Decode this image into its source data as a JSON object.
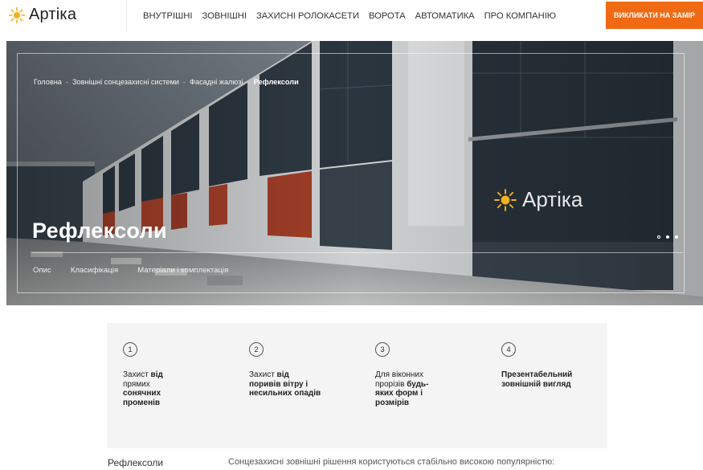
{
  "header": {
    "logo_text": "Артіка",
    "nav": [
      "ВНУТРІШНІ",
      "ЗОВНІШНІ",
      "ЗАХИСНІ РОЛОКАСЕТИ",
      "ВОРОТА",
      "АВТОМАТИКА",
      "ПРО КОМПАНІЮ"
    ],
    "cta": "ВИКЛИКАТИ НА ЗАМІР"
  },
  "hero": {
    "breadcrumb": [
      "Головна",
      "Зовнішні сонцезахисні системи",
      "Фасадні жалюзі",
      "Рефлексоли"
    ],
    "breadcrumb_sep": "-",
    "title": "Рефлексоли",
    "tabs": [
      "Опис",
      "Класифікація",
      "Матеріали і комплектація"
    ],
    "watermark": "Артіка"
  },
  "features": [
    {
      "num": "1",
      "plain": "Захист ",
      "bold": "від",
      "plain2": " прямих ",
      "bold2": "сонячних променів"
    },
    {
      "num": "2",
      "plain": "Захист ",
      "bold": "від поривів вітру і несильних опадів",
      "plain2": "",
      "bold2": ""
    },
    {
      "num": "3",
      "plain": "Для віконних прорізів ",
      "bold": "будь-яких форм і розмірів",
      "plain2": "",
      "bold2": ""
    },
    {
      "num": "4",
      "plain": "",
      "bold": "Презентабельний зовнішній вигляд",
      "plain2": "",
      "bold2": ""
    }
  ],
  "bottom": {
    "title": "Рефлексоли",
    "text": "Сонцезахисні зовнішні рішення користуються стабільно високою популярністю:"
  },
  "colors": {
    "accent": "#f06a14",
    "logo_sun": "#f2b01e"
  }
}
